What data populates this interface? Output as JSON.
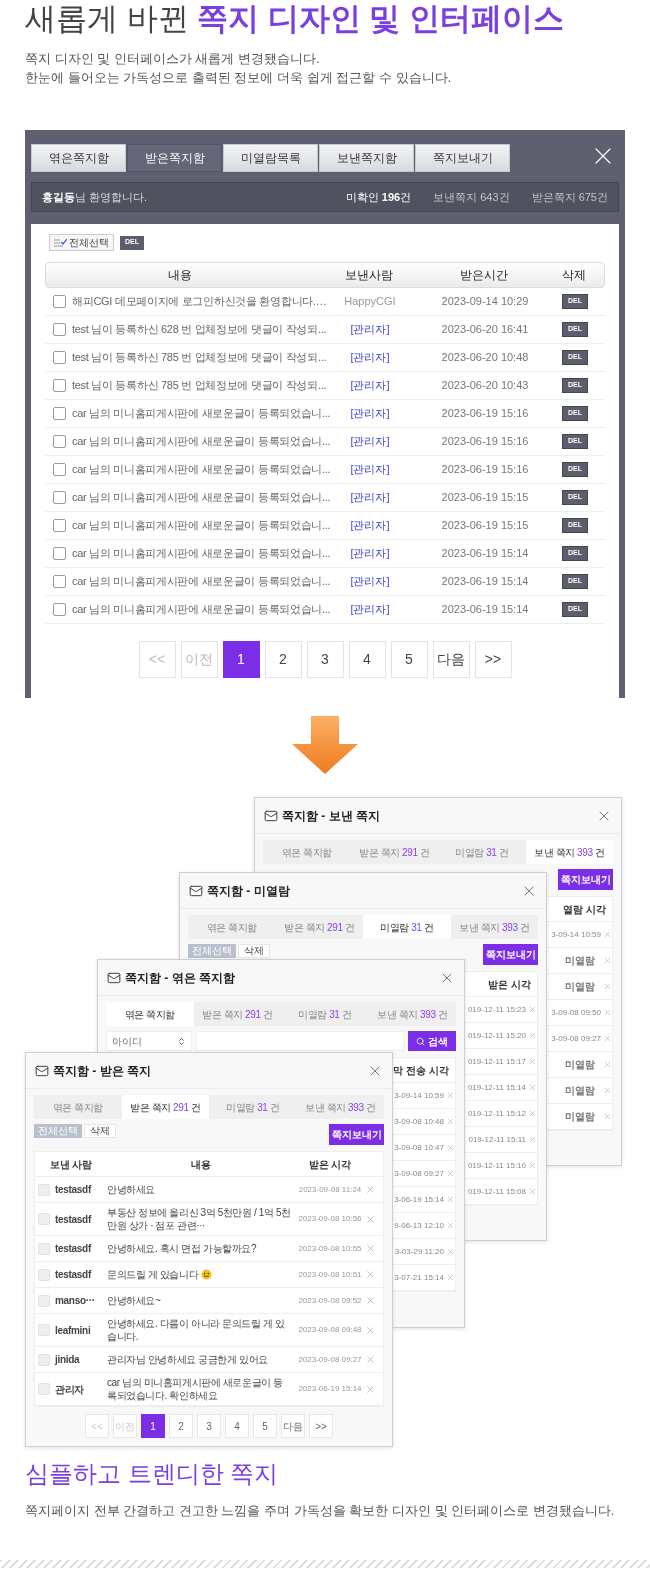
{
  "heading": {
    "text": "새롭게 바뀐",
    "highlight": "쪽지 디자인 및 인터페이스"
  },
  "intro": [
    "쪽지 디자인 및 인터페이스가 새롭게 변경됐습니다.",
    "한눈에 들어오는 가독성으로 출력된 정보에 더욱 쉽게 접근할 수 있습니다."
  ],
  "old_window": {
    "tabs": [
      {
        "label": "엮은쪽지함",
        "selected": false
      },
      {
        "label": "받은쪽지함",
        "selected": true
      },
      {
        "label": "미열람목록",
        "selected": false
      },
      {
        "label": "보낸쪽지함",
        "selected": false
      },
      {
        "label": "쪽지보내기",
        "selected": false
      }
    ],
    "welcome": "**홍길동**님 환영합니다.",
    "stats": [
      {
        "text": "미확인 **196**건",
        "highlighted": true
      },
      {
        "text": "보낸쪽지 643건",
        "highlighted": false
      },
      {
        "text": "받은쪽지 675건",
        "highlighted": false
      }
    ],
    "select_all": "전체선택",
    "delete": "DEL",
    "columns": [
      "내용",
      "보낸사람",
      "받은시간",
      "삭제"
    ],
    "rows": [
      {
        "content": "해피CGI 데모페이지에 로그인하신것을 환영합니다.…",
        "sender": "HappyCGI",
        "kind": "user",
        "time": "2023-09-14 10:29",
        "delete": "DEL",
        "checked": false
      },
      {
        "content": "test 님이 등록하신 628 번 업체정보에 댓글이 작성되...",
        "sender": "[관리자]",
        "kind": "admin",
        "time": "2023-06-20 16:41",
        "delete": "DEL",
        "checked": false
      },
      {
        "content": "test 님이 등록하신 785 번 업체정보에 댓글이 작성되...",
        "sender": "[관리자]",
        "kind": "admin",
        "time": "2023-06-20 10:48",
        "delete": "DEL",
        "checked": false
      },
      {
        "content": "test 님이 등록하신 785 번 업체정보에 댓글이 작성되...",
        "sender": "[관리자]",
        "kind": "admin",
        "time": "2023-06-20 10:43",
        "delete": "DEL",
        "checked": false
      },
      {
        "content": "car 님의 미니홈피게시판에 새로운글이 등록되었습니...",
        "sender": "[관리자]",
        "kind": "admin",
        "time": "2023-06-19 15:16",
        "delete": "DEL",
        "checked": false
      },
      {
        "content": "car 님의 미니홈피게시판에 새로운글이 등록되었습니...",
        "sender": "[관리자]",
        "kind": "admin",
        "time": "2023-06-19 15:16",
        "delete": "DEL",
        "checked": false
      },
      {
        "content": "car 님의 미니홈피게시판에 새로운글이 등록되었습니...",
        "sender": "[관리자]",
        "kind": "admin",
        "time": "2023-06-19 15:16",
        "delete": "DEL",
        "checked": false
      },
      {
        "content": "car 님의 미니홈피게시판에 새로운글이 등록되었습니...",
        "sender": "[관리자]",
        "kind": "admin",
        "time": "2023-06-19 15:15",
        "delete": "DEL",
        "checked": false
      },
      {
        "content": "car 님의 미니홈피게시판에 새로운글이 등록되었습니...",
        "sender": "[관리자]",
        "kind": "admin",
        "time": "2023-06-19 15:15",
        "delete": "DEL",
        "checked": false
      },
      {
        "content": "car 님의 미니홈피게시판에 새로운글이 등록되었습니...",
        "sender": "[관리자]",
        "kind": "admin",
        "time": "2023-06-19 15:14",
        "delete": "DEL",
        "checked": false
      },
      {
        "content": "car 님의 미니홈피게시판에 새로운글이 등록되었습니...",
        "sender": "[관리자]",
        "kind": "admin",
        "time": "2023-06-19 15:14",
        "delete": "DEL",
        "checked": false
      },
      {
        "content": "car 님의 미니홈피게시판에 새로운글이 등록되었습니...",
        "sender": "[관리자]",
        "kind": "admin",
        "time": "2023-06-19 15:14",
        "delete": "DEL",
        "checked": false
      }
    ],
    "pagination": [
      {
        "label": "<<",
        "selected": false,
        "disabled": true
      },
      {
        "label": "이전",
        "selected": false,
        "disabled": true
      },
      {
        "label": "1",
        "selected": true,
        "disabled": false
      },
      {
        "label": "2",
        "selected": false,
        "disabled": false
      },
      {
        "label": "3",
        "selected": false,
        "disabled": false
      },
      {
        "label": "4",
        "selected": false,
        "disabled": false
      },
      {
        "label": "5",
        "selected": false,
        "disabled": false
      },
      {
        "label": "다음",
        "selected": false,
        "disabled": false
      },
      {
        "label": ">>",
        "selected": false,
        "disabled": false
      }
    ]
  },
  "new_windows": [
    {
      "kind": "back",
      "title": "쪽지함 - 보낸 쪽지",
      "tabs": [
        {
          "label": "엮은 쪽지함",
          "selected": false
        },
        {
          "label": "받은 쪽지",
          "count": "291",
          "unit": "건",
          "selected": false
        },
        {
          "label": "미열람",
          "count": "31",
          "unit": "건",
          "selected": false
        },
        {
          "label": "보낸 쪽지",
          "count": "393",
          "unit": "건",
          "selected": true
        }
      ],
      "compose": "쪽지보내기",
      "column": "열람 시각",
      "rows": [
        {
          "time": "3-09-14 10:59",
          "read": true
        },
        {
          "time": "미열람",
          "read": false
        },
        {
          "time": "미열람",
          "read": false
        },
        {
          "time": "3-09-08 09:50",
          "read": true
        },
        {
          "time": "3-09-08 09:27",
          "read": true
        },
        {
          "time": "미열람",
          "read": false
        },
        {
          "time": "미열람",
          "read": false
        },
        {
          "time": "미열람",
          "read": false
        }
      ]
    },
    {
      "kind": "back",
      "title": "쪽지함 - 미열람",
      "tabs": [
        {
          "label": "엮은 쪽지함",
          "selected": false
        },
        {
          "label": "받은 쪽지",
          "count": "291",
          "unit": "건",
          "selected": false
        },
        {
          "label": "미열람",
          "count": "31",
          "unit": "건",
          "selected": true
        },
        {
          "label": "보낸 쪽지",
          "count": "393",
          "unit": "건",
          "selected": false
        }
      ],
      "select_all": "전체선택",
      "delete": "삭제",
      "compose": "쪽지보내기",
      "column": "받은 시각",
      "rows": [
        {
          "time": "019-12-11 15:23",
          "read": true
        },
        {
          "time": "019-12-11 15:20",
          "read": true
        },
        {
          "time": "019-12-11 15:17",
          "read": true
        },
        {
          "time": "019-12-11 15:14",
          "read": true
        },
        {
          "time": "019-12-11 15:12",
          "read": true
        },
        {
          "time": "019-12-11 15:11",
          "read": true
        },
        {
          "time": "019-12-11 15:10",
          "read": true
        },
        {
          "time": "019-12-11 15:08",
          "read": true
        }
      ]
    },
    {
      "kind": "back",
      "title": "쪽지함 - 엮은 쪽지함",
      "tabs": [
        {
          "label": "엮은 쪽지함",
          "selected": true
        },
        {
          "label": "받은 쪽지",
          "count": "291",
          "unit": "건",
          "selected": false
        },
        {
          "label": "미열람",
          "count": "31",
          "unit": "건",
          "selected": false
        },
        {
          "label": "보낸 쪽지",
          "count": "393",
          "unit": "건",
          "selected": false
        }
      ],
      "search": {
        "field": "아이디",
        "button": "검색"
      },
      "column": "막 전송 시각",
      "rows": [
        {
          "time": "3-09-14 10:59",
          "read": true
        },
        {
          "time": "3-09-08 10:48",
          "read": true
        },
        {
          "time": "3-09-08 10:47",
          "read": true
        },
        {
          "time": "3-09-08 09:27",
          "read": true
        },
        {
          "time": "3-06-19 15:14",
          "read": true
        },
        {
          "time": "9-06-13 12:10",
          "read": true
        },
        {
          "time": "3-03-29 11:20",
          "read": true
        },
        {
          "time": "3-07-21 15:14",
          "read": true
        }
      ]
    },
    {
      "kind": "front",
      "title": "쪽지함 - 받은 쪽지",
      "tabs": [
        {
          "label": "엮은 쪽지함",
          "selected": false
        },
        {
          "label": "받은 쪽지",
          "count": "291",
          "unit": "건",
          "selected": true
        },
        {
          "label": "미열람",
          "count": "31",
          "unit": "건",
          "selected": false
        },
        {
          "label": "보낸 쪽지",
          "count": "393",
          "unit": "건",
          "selected": false
        }
      ],
      "select_all": "전체선택",
      "delete": "삭제",
      "compose": "쪽지보내기",
      "columns": [
        "보낸 사람",
        "내용",
        "받은 시각"
      ],
      "rows": [
        {
          "sender": "testasdf",
          "content": "안녕하세요",
          "emoji": false,
          "time": "2023-09-08 11:24",
          "checked": false
        },
        {
          "sender": "testasdf",
          "content": "부동산 정보에 올리신 3억 5천만원 / 1억 5천만원 상가 · 점포 관련···",
          "emoji": false,
          "time": "2023-09-08 10:56",
          "checked": false
        },
        {
          "sender": "testasdf",
          "content": "안녕하세요. 혹시 면접 가능할까요?",
          "emoji": false,
          "time": "2023-09-08 10:55",
          "checked": false
        },
        {
          "sender": "testasdf",
          "content": "문의드릴 게 있습니다",
          "emoji": true,
          "time": "2023-09-08 10:51",
          "checked": false
        },
        {
          "sender": "manso···",
          "content": "안녕하세요~",
          "emoji": false,
          "time": "2023-09-08 09:52",
          "checked": false
        },
        {
          "sender": "leafmini",
          "content": "안녕하세요. 다름이 아니라 문의드릴 게 있습니다.",
          "emoji": false,
          "time": "2023-09-08 09:48",
          "checked": false
        },
        {
          "sender": "jinida",
          "content": "관리자님 안녕하세요 궁금한게 있어요",
          "emoji": false,
          "time": "2023-09-08 09:27",
          "checked": false
        },
        {
          "sender": "관리자",
          "content": "car 님의 미니홈피게시판에 새로운글이 등록되었습니다. 확인하세요",
          "emoji": false,
          "time": "2023-06-19 15:14",
          "checked": false
        }
      ],
      "pagination": [
        {
          "label": "<<",
          "selected": false,
          "disabled": true
        },
        {
          "label": "이전",
          "selected": false,
          "disabled": true
        },
        {
          "label": "1",
          "selected": true,
          "disabled": false
        },
        {
          "label": "2",
          "selected": false,
          "disabled": false
        },
        {
          "label": "3",
          "selected": false,
          "disabled": false
        },
        {
          "label": "4",
          "selected": false,
          "disabled": false
        },
        {
          "label": "5",
          "selected": false,
          "disabled": false
        },
        {
          "label": "다음",
          "selected": false,
          "disabled": false
        },
        {
          "label": ">>",
          "selected": false,
          "disabled": false
        }
      ]
    }
  ],
  "footer": {
    "title": "심플하고 트렌디한 쪽지",
    "text": "쪽지페이지 전부 간결하고 견고한 느낌을 주며 가독성을 확보한 디자인 및 인터페이스로 변경됐습니다."
  }
}
